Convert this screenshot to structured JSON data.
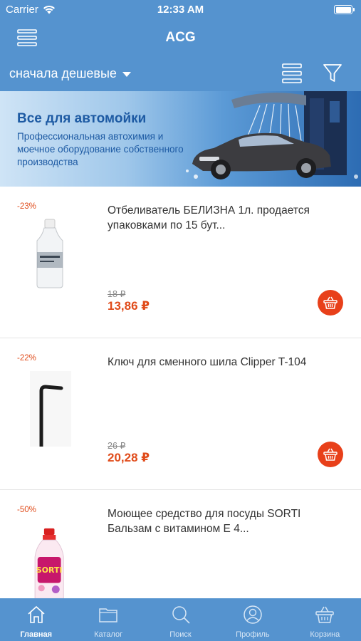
{
  "status_bar": {
    "carrier": "Carrier",
    "time": "12:33 AM"
  },
  "nav": {
    "title": "ACG",
    "menu_icon": "hamburger-menu-icon"
  },
  "sort": {
    "label": "сначала дешевые",
    "view_icon": "list-view-icon",
    "filter_icon": "filter-icon"
  },
  "banner": {
    "title": "Все для автомойки",
    "text": "Профессиональная автохимия и моечное оборудование собственного производства"
  },
  "products": [
    {
      "discount": "-23%",
      "name": "Отбеливатель БЕЛИЗНА 1л. продается упаковками по 15 бут...",
      "old_price": "18 ₽",
      "price": "13,86 ₽"
    },
    {
      "discount": "-22%",
      "name": "Ключ для сменного шила Clipper T-104",
      "old_price": "26 ₽",
      "price": "20,28 ₽"
    },
    {
      "discount": "-50%",
      "name": "Моющее средство для посуды SORTI Бальзам с витамином Е 4...",
      "old_price": "",
      "price": ""
    }
  ],
  "tabs": [
    {
      "label": "Главная",
      "icon": "home-icon",
      "active": true
    },
    {
      "label": "Каталог",
      "icon": "folder-icon",
      "active": false
    },
    {
      "label": "Поиск",
      "icon": "search-icon",
      "active": false
    },
    {
      "label": "Профиль",
      "icon": "user-icon",
      "active": false
    },
    {
      "label": "Корзина",
      "icon": "basket-icon",
      "active": false
    }
  ],
  "colors": {
    "primary": "#5593cf",
    "accent": "#e8401a",
    "discount": "#e04b1a"
  }
}
